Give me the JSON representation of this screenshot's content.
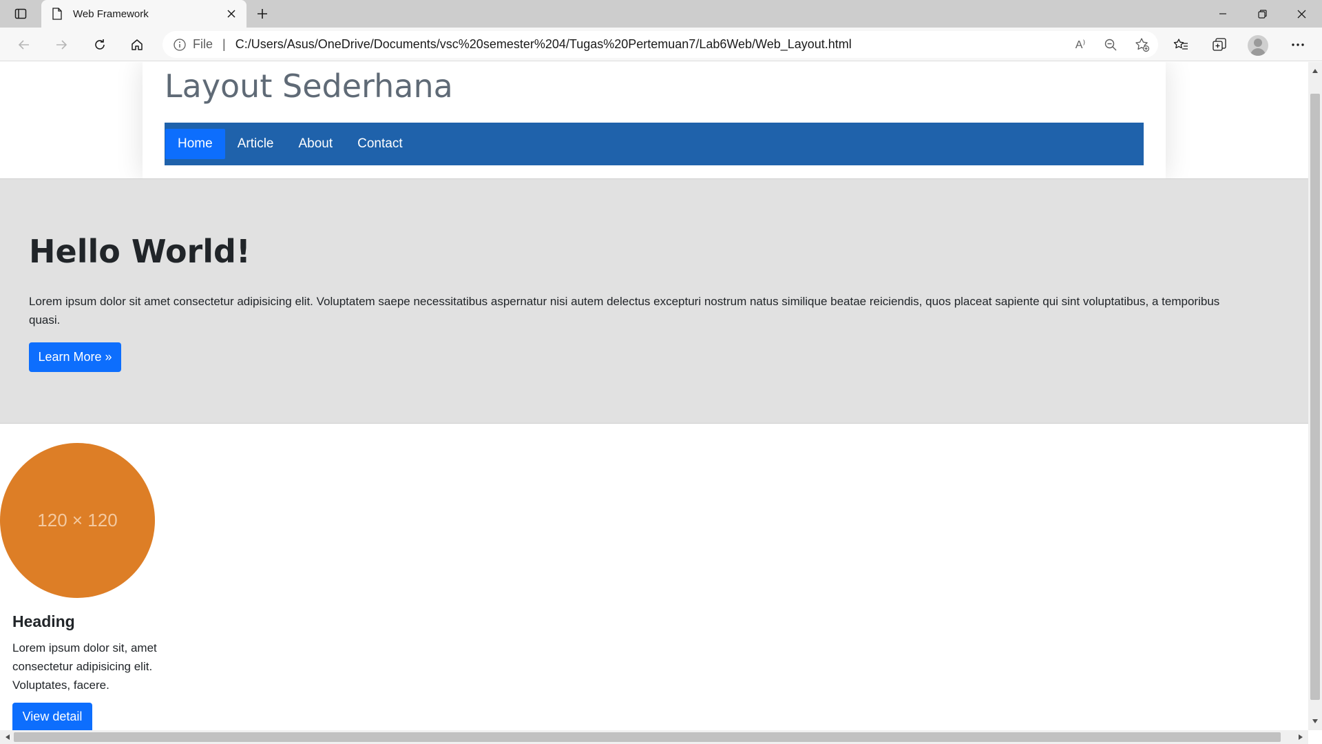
{
  "browser": {
    "tab_title": "Web Framework",
    "address": {
      "scheme_label": "File",
      "separator": "|",
      "url": "C:/Users/Asus/OneDrive/Documents/vsc%20semester%204/Tugas%20Pertemuan7/Lab6Web/Web_Layout.html"
    },
    "icons": {
      "tab_actions": "tab-actions-icon",
      "tab_page": "page-icon",
      "tab_close": "close-icon",
      "new_tab": "plus-icon",
      "minimize": "minimize-icon",
      "restore": "restore-icon",
      "close_window": "close-icon",
      "back": "back-arrow-icon",
      "forward": "forward-arrow-icon",
      "refresh": "refresh-icon",
      "home": "home-icon",
      "info": "info-icon",
      "read_aloud": "read-aloud-icon",
      "zoom_out": "zoom-out-icon",
      "add_favorite": "add-favorite-icon",
      "favorites": "favorites-icon",
      "collections": "collections-icon",
      "profile": "avatar",
      "more": "more-icon"
    },
    "read_aloud_glyph": "A⁾"
  },
  "page": {
    "site_title": "Layout Sederhana",
    "nav": [
      {
        "label": "Home",
        "active": true
      },
      {
        "label": "Article",
        "active": false
      },
      {
        "label": "About",
        "active": false
      },
      {
        "label": "Contact",
        "active": false
      }
    ],
    "hero": {
      "title": "Hello World!",
      "text": "Lorem ipsum dolor sit amet consectetur adipisicing elit. Voluptatem saepe necessitatibus aspernatur nisi autem delectus excepturi nostrum natus similique beatae reiciendis, quos placeat sapiente qui sint voluptatibus, a temporibus quasi.",
      "button_label": "Learn More »"
    },
    "card": {
      "image_label": "120 × 120",
      "heading": "Heading",
      "text": "Lorem ipsum dolor sit, amet consectetur adipisicing elit. Voluptates, facere.",
      "button_label": "View detail"
    }
  },
  "colors": {
    "navbar": "#1f62ab",
    "nav_active": "#0d6efd",
    "primary_button": "#0d6efd",
    "hero_background": "#e1e1e1",
    "placeholder_circle": "#dd7e26",
    "site_title": "#5f6a76"
  }
}
